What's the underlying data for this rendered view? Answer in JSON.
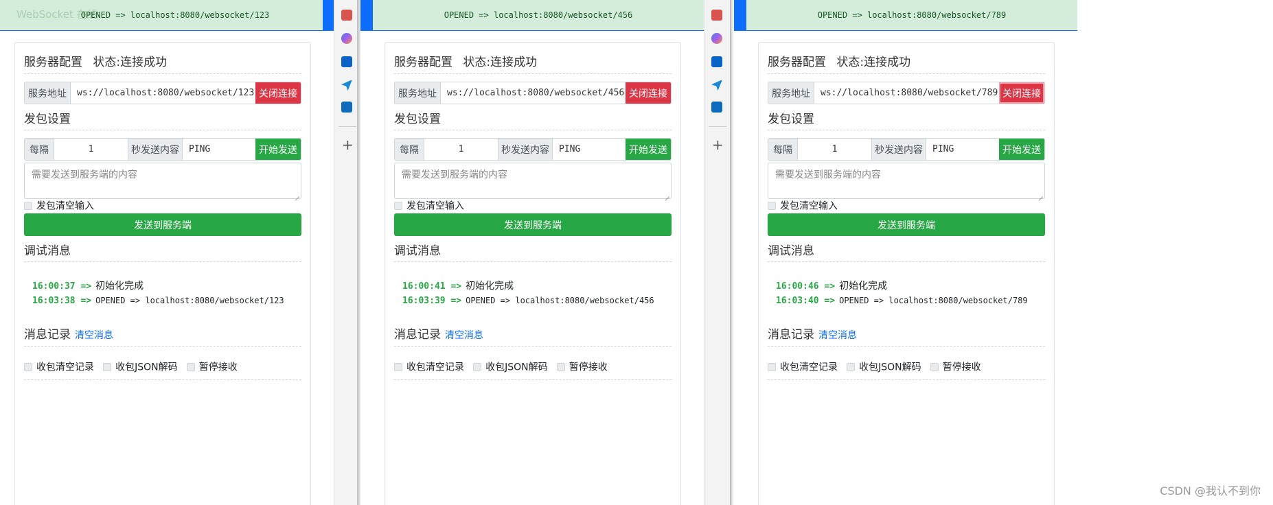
{
  "common": {
    "server_config_title": "服务器配置",
    "status_label": "状态:",
    "status_value": "连接成功",
    "server_address_label": "服务地址",
    "close_button": "关闭连接",
    "send_settings_title": "发包设置",
    "every_label": "每隔",
    "interval_value": "1",
    "seconds_send_label": "秒发送内容",
    "ping_value": "PING",
    "start_send_button": "开始发送",
    "textarea_placeholder": "需要发送到服务端的内容",
    "clear_input_label": "发包清空输入",
    "send_to_server_button": "发送到服务端",
    "debug_title": "调试消息",
    "init_done": "初始化完成",
    "message_log_title": "消息记录",
    "clear_messages_link": "清空消息",
    "clear_records_label": "收包清空记录",
    "json_decode_label": "收包JSON解码",
    "pause_receive_label": "暂停接收"
  },
  "ghost_title": "WebSocket 在线",
  "watermark": "CSDN @我认不到你",
  "windows": [
    {
      "toast": "OPENED => localhost:8080/websocket/123",
      "address": "ws://localhost:8080/websocket/123",
      "log1_time": "16:00:37 =>",
      "log2_time": "16:03:38 =>",
      "log2_text": "OPENED => localhost:8080/websocket/123"
    },
    {
      "toast": "OPENED => localhost:8080/websocket/456",
      "address": "ws://localhost:8080/websocket/456",
      "log1_time": "16:00:41 =>",
      "log2_time": "16:03:39 =>",
      "log2_text": "OPENED => localhost:8080/websocket/456"
    },
    {
      "toast": "OPENED => localhost:8080/websocket/789",
      "address": "ws://localhost:8080/websocket/789",
      "log1_time": "16:00:46 =>",
      "log2_time": "16:03:40 =>",
      "log2_text": "OPENED => localhost:8080/websocket/789"
    }
  ],
  "colors": {
    "primary": "#0d6efd",
    "success": "#28a745",
    "danger": "#dc3545",
    "toast_bg": "#d4edda"
  },
  "sidebar_icons": [
    "toolbox-icon",
    "copilot-icon",
    "outlook-icon",
    "send-icon",
    "outlook-mail-icon"
  ]
}
